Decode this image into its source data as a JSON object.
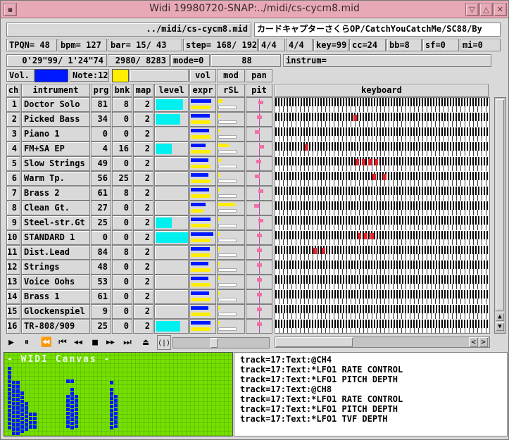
{
  "window": {
    "title": "Widi 19980720-SNAP:../midi/cs-cycm8.mid",
    "buttons": {
      "min": "▽",
      "max": "△",
      "close": "✕"
    }
  },
  "file": {
    "path": "../midi/cs-cycm8.mid",
    "song_title": "カードキャプターさくらOP/CatchYouCatchMe/SC88/By"
  },
  "status": {
    "tpqn": "TPQN=  48",
    "bpm": "bpm= 127",
    "bar": "bar=  15/  43",
    "step": "step= 168/ 192",
    "sig1": "4/4",
    "sig2": "4/4",
    "key": "key=99",
    "cc": "cc=24",
    "bb": "bb=8",
    "sf": "sf=0",
    "mi": "mi=0",
    "time1": "0'29\"99/ 1'24\"74",
    "ticks": "2980/  8283",
    "mode": "mode=0",
    "num": "88",
    "instrum": "instrum="
  },
  "legend": {
    "vol": "Vol.",
    "note": "Note:12",
    "vol_color": "#0018ff",
    "note_color": "#ffee00"
  },
  "headers": {
    "ch": "ch",
    "instrument": "intrument",
    "prg": "prg",
    "bnk": "bnk",
    "map": "map",
    "level": "level",
    "vol": "vol",
    "mod": "mod",
    "pan": "pan",
    "expr": "expr",
    "rsl": "rSL",
    "pit": "pit",
    "keyboard": "keyboard"
  },
  "channels": [
    {
      "ch": "1",
      "name": "Doctor Solo",
      "prg": "81",
      "bnk": "8",
      "map": "2",
      "level": 0.85,
      "vol": 0.82,
      "expr": 0.8,
      "mod": 0.15,
      "pan": 0.55
    },
    {
      "ch": "2",
      "name": "Picked Bass",
      "prg": "34",
      "bnk": "0",
      "map": "2",
      "level": 0.75,
      "vol": 0.78,
      "expr": 0.8,
      "mod": 0.05,
      "pan": 0.5
    },
    {
      "ch": "3",
      "name": "Piano 1",
      "prg": "0",
      "bnk": "0",
      "map": "2",
      "level": 0.0,
      "vol": 0.75,
      "expr": 0.8,
      "mod": 0.05,
      "pan": 0.4
    },
    {
      "ch": "4",
      "name": "FM+SA EP",
      "prg": "4",
      "bnk": "16",
      "map": "2",
      "level": 0.5,
      "vol": 0.6,
      "expr": 0.8,
      "mod": 0.4,
      "pan": 0.6
    },
    {
      "ch": "5",
      "name": "Slow Strings",
      "prg": "49",
      "bnk": "0",
      "map": "2",
      "level": 0.0,
      "vol": 0.7,
      "expr": 0.8,
      "mod": 0.1,
      "pan": 0.45
    },
    {
      "ch": "6",
      "name": "Warm Tp.",
      "prg": "56",
      "bnk": "25",
      "map": "2",
      "level": 0.0,
      "vol": 0.72,
      "expr": 0.8,
      "mod": 0.05,
      "pan": 0.4
    },
    {
      "ch": "7",
      "name": "Brass 2",
      "prg": "61",
      "bnk": "8",
      "map": "2",
      "level": 0.0,
      "vol": 0.74,
      "expr": 0.8,
      "mod": 0.05,
      "pan": 0.55
    },
    {
      "ch": "8",
      "name": "Clean Gt.",
      "prg": "27",
      "bnk": "0",
      "map": "2",
      "level": 0.0,
      "vol": 0.6,
      "expr": 0.5,
      "mod": 0.65,
      "pan": 0.35
    },
    {
      "ch": "9",
      "name": "Steel-str.Gt",
      "prg": "25",
      "bnk": "0",
      "map": "2",
      "level": 0.5,
      "vol": 0.8,
      "expr": 0.8,
      "mod": 0.05,
      "pan": 0.55
    },
    {
      "ch": "10",
      "name": "STANDARD 1",
      "prg": "0",
      "bnk": "0",
      "map": "2",
      "level": 1.0,
      "vol": 0.9,
      "expr": 0.8,
      "mod": 0.05,
      "pan": 0.5
    },
    {
      "ch": "11",
      "name": "Dist.Lead",
      "prg": "84",
      "bnk": "8",
      "map": "2",
      "level": 0.0,
      "vol": 0.78,
      "expr": 0.8,
      "mod": 0.05,
      "pan": 0.5
    },
    {
      "ch": "12",
      "name": "Strings",
      "prg": "48",
      "bnk": "0",
      "map": "2",
      "level": 0.0,
      "vol": 0.72,
      "expr": 0.8,
      "mod": 0.05,
      "pan": 0.5
    },
    {
      "ch": "13",
      "name": "Voice Oohs",
      "prg": "53",
      "bnk": "0",
      "map": "2",
      "level": 0.0,
      "vol": 0.7,
      "expr": 0.8,
      "mod": 0.05,
      "pan": 0.5
    },
    {
      "ch": "14",
      "name": "Brass 1",
      "prg": "61",
      "bnk": "0",
      "map": "2",
      "level": 0.0,
      "vol": 0.75,
      "expr": 0.8,
      "mod": 0.05,
      "pan": 0.5
    },
    {
      "ch": "15",
      "name": "Glockenspiel",
      "prg": "9",
      "bnk": "0",
      "map": "2",
      "level": 0.0,
      "vol": 0.7,
      "expr": 0.8,
      "mod": 0.05,
      "pan": 0.5
    },
    {
      "ch": "16",
      "name": "TR-808/909",
      "prg": "25",
      "bnk": "0",
      "map": "2",
      "level": 0.75,
      "vol": 0.8,
      "expr": 0.8,
      "mod": 0.05,
      "pan": 0.5
    }
  ],
  "active_notes": [
    {
      "row": 1,
      "key": 0.37
    },
    {
      "row": 3,
      "key": 0.14
    },
    {
      "row": 4,
      "key": 0.38
    },
    {
      "row": 4,
      "key": 0.41
    },
    {
      "row": 4,
      "key": 0.44
    },
    {
      "row": 4,
      "key": 0.47
    },
    {
      "row": 5,
      "key": 0.46
    },
    {
      "row": 5,
      "key": 0.51
    },
    {
      "row": 9,
      "key": 0.39
    },
    {
      "row": 9,
      "key": 0.42
    },
    {
      "row": 9,
      "key": 0.45
    },
    {
      "row": 10,
      "key": 0.22
    },
    {
      "row": 10,
      "key": 0.18
    }
  ],
  "controls": {
    "play": "▶",
    "pause": "⏸",
    "rew_fast": "⏪",
    "prev": "⏮",
    "back": "◀◀",
    "stop": "■",
    "fwd": "▶▶",
    "next": "⏭",
    "eject": "⏏",
    "lr": "⟨|⟩",
    "scroll_left": "<",
    "scroll_right": ">",
    "position": 0.12
  },
  "canvas": {
    "title": "- WIDI  Canvas -",
    "glyph_color": "#0018ff"
  },
  "log": [
    "track=17:Text:@CH4",
    "track=17:Text:*LFO1 RATE CONTROL",
    "track=17:Text:*LFO1 PITCH DEPTH",
    "track=17:Text:@CH8",
    "track=17:Text:*LFO1 RATE CONTROL",
    "track=17:Text:*LFO1 PITCH DEPTH",
    "track=17:Text:*LFO1 TVF DEPTH"
  ]
}
